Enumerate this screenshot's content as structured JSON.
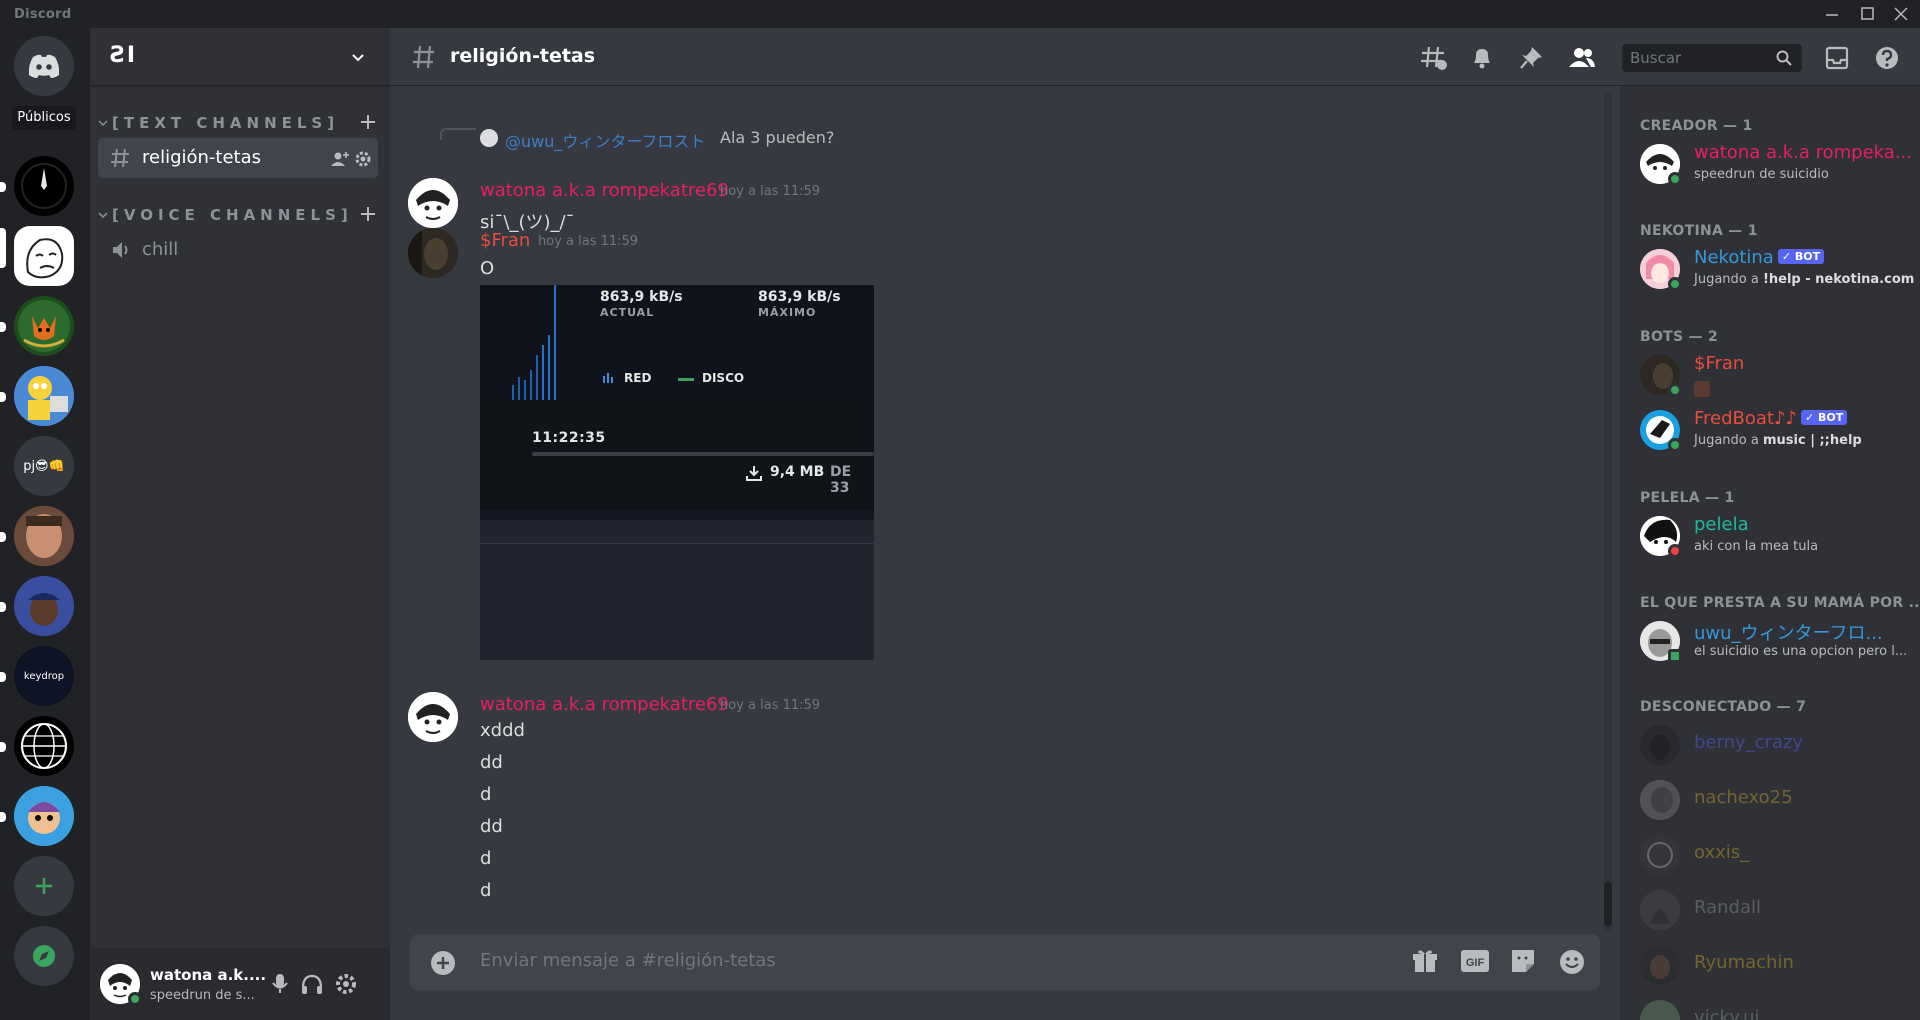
{
  "window": {
    "app_name": "Discord"
  },
  "rail": {
    "publicos_label": "Públicos",
    "text_server_label": "pj😎👊",
    "keydrop_label": "keydrop"
  },
  "guild": {
    "name": "ƧI"
  },
  "categories": {
    "text": "[TEXT CHANNELS]",
    "voice": "[VOICE CHANNELS]"
  },
  "channels": {
    "text": [
      {
        "name": "religión-tetas"
      }
    ],
    "voice": [
      {
        "name": "chill"
      }
    ]
  },
  "header": {
    "channel": "religión-tetas",
    "search_placeholder": "Buscar"
  },
  "messages": [
    {
      "reply": {
        "name": "@uwu_ウィンターフロスト",
        "text": "Ala 3 pueden?"
      },
      "author": "watona a.k.a rompekatre69",
      "timestamp": "hoy a las 11:59",
      "lines": [
        "si¯\\_(ツ)_/¯"
      ]
    },
    {
      "author": "$Fran",
      "timestamp": "hoy a las 11:59",
      "lines": [
        "O"
      ],
      "embed": {
        "current_speed": "863,9 kB/s",
        "current_label": "ACTUAL",
        "max_speed": "863,9 kB/s",
        "max_label": "MÁXIMO",
        "legend_red": "RED",
        "legend_disk": "DISCO",
        "time": "11:22:35",
        "download_text": "9,4 MB",
        "download_of": "DE 33"
      }
    },
    {
      "author": "watona a.k.a rompekatre69",
      "timestamp": "hoy a las 11:59",
      "lines": [
        "xddd",
        "dd",
        "d",
        "dd",
        "d",
        "d"
      ]
    }
  ],
  "composer": {
    "placeholder": "Enviar mensaje a #religión-tetas"
  },
  "user_panel": {
    "name": "watona a.k....",
    "status": "speedrun de s..."
  },
  "members": {
    "groups": [
      {
        "label": "CREADOR — 1"
      },
      {
        "label": "NEKOTINA — 1"
      },
      {
        "label": "BOTS — 2"
      },
      {
        "label": "PELELA — 1"
      },
      {
        "label": "EL QUE PRESTA A SU MAMÁ POR ..."
      },
      {
        "label": "DESCONECTADO — 7"
      }
    ],
    "list": [
      {
        "name": "watona a.k.a rompeka...",
        "activity": "speedrun de suicidio",
        "color": "#e91e63"
      },
      {
        "name": "Nekotina",
        "badge": "✓ BOT",
        "activity_prefix": "Jugando a ",
        "activity": "!help - nekotina.com",
        "color": "#3498db"
      },
      {
        "name": "$Fran",
        "color": "#e74c3c"
      },
      {
        "name": "FredBoat♪♪",
        "badge": "✓ BOT",
        "activity_prefix": "Jugando a ",
        "activity": "music | ;;help",
        "color": "#e74c3c"
      },
      {
        "name": "pelela",
        "activity": "aki con la mea tula",
        "color": "#1abc9c"
      },
      {
        "name": "uwu_ウィンターフロ...",
        "activity": "el suicidio es una opcion pero l...",
        "color": "#3498db"
      },
      {
        "name": "berny_crazy",
        "color": "#5865f2"
      },
      {
        "name": "nachexo25",
        "color": "#c9a227"
      },
      {
        "name": "oxxis_",
        "color": "#c9a227"
      },
      {
        "name": "Randall",
        "color": "#8e9297"
      },
      {
        "name": "Ryumachin",
        "color": "#c9a227"
      },
      {
        "name": "vicky.ui",
        "color": "#8e9297"
      }
    ]
  },
  "colors": {
    "accent": "#5865f2",
    "online": "#3ba55d",
    "dnd": "#ed4245",
    "author_pink": "#e91e63",
    "author_red": "#e74c3c"
  }
}
